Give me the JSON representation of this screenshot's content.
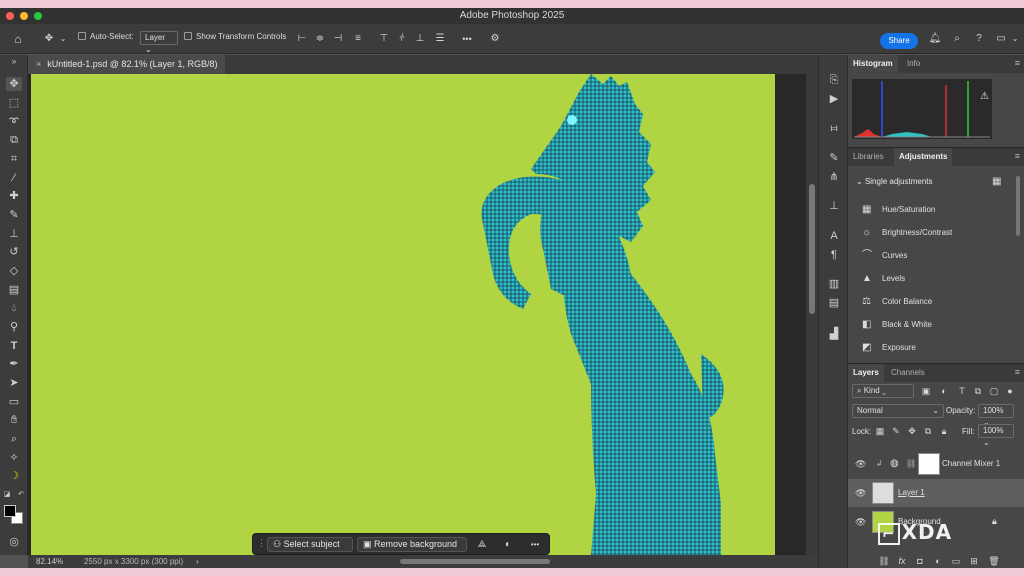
{
  "window": {
    "title": "Adobe Photoshop 2025"
  },
  "options": {
    "auto_select_label": "Auto-Select:",
    "auto_select_value": "Layer",
    "transform_label": "Show Transform Controls",
    "more": "•••",
    "share_label": "Share"
  },
  "document": {
    "tab_title": "kUntitled-1.psd @ 82.1% (Layer 1, RGB/8)",
    "canvas_color": "#b1d443"
  },
  "status": {
    "zoom": "82.14%",
    "info": "2550 px x 3300 px (300 ppi)",
    "arrow": "›"
  },
  "context_bar": {
    "select_subject": "Select subject",
    "remove_background": "Remove background",
    "more": "•••"
  },
  "histogram_panel": {
    "tabs": [
      "Histogram",
      "Info"
    ],
    "warning": "⚠"
  },
  "adjustments_panel": {
    "tabs": [
      "Libraries",
      "Adjustments"
    ],
    "section": "Single adjustments",
    "items": [
      {
        "label": "Hue/Saturation",
        "icon": "▦"
      },
      {
        "label": "Brightness/Contrast",
        "icon": "☼"
      },
      {
        "label": "Curves",
        "icon": "⌒"
      },
      {
        "label": "Levels",
        "icon": "▲"
      },
      {
        "label": "Color Balance",
        "icon": "⚖"
      },
      {
        "label": "Black & White",
        "icon": "◧"
      },
      {
        "label": "Exposure",
        "icon": "◩"
      }
    ]
  },
  "layers_panel": {
    "tabs": [
      "Layers",
      "Channels"
    ],
    "kind": "Kind",
    "blend_mode": "Normal",
    "opacity_label": "Opacity:",
    "opacity_value": "100%",
    "lock_label": "Lock:",
    "fill_label": "Fill:",
    "fill_value": "100%",
    "layers": [
      {
        "name": "Channel Mixer 1",
        "selected": false
      },
      {
        "name": "Layer 1",
        "selected": true
      },
      {
        "name": "Background",
        "selected": false
      }
    ]
  },
  "watermark": "XDA"
}
